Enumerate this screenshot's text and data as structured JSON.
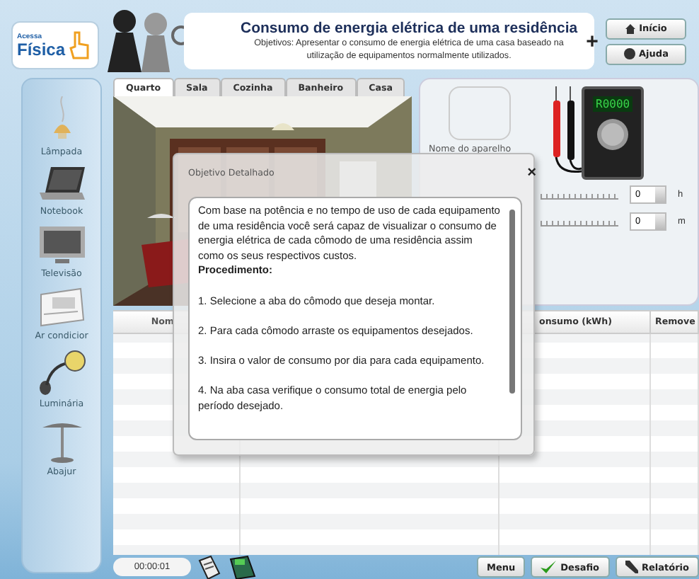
{
  "logo": {
    "top": "Acessa",
    "bottom": "Física"
  },
  "header": {
    "title": "Consumo de energia elétrica de uma residência",
    "objective": "Objetivos: Apresentar o consumo de energia elétrica de uma casa baseado na utilização de equipamentos normalmente utilizados.",
    "expand": "+",
    "buttons": [
      {
        "label": "Início"
      },
      {
        "label": "Ajuda"
      }
    ]
  },
  "sidebar": {
    "items": [
      {
        "label": "Lâmpada"
      },
      {
        "label": "Notebook"
      },
      {
        "label": "Televisão"
      },
      {
        "label": "Ar condicior"
      },
      {
        "label": "Luminária"
      },
      {
        "label": "Abajur"
      }
    ]
  },
  "tabs": [
    {
      "label": "Quarto",
      "selected": true
    },
    {
      "label": "Sala",
      "selected": false
    },
    {
      "label": "Cozinha",
      "selected": false
    },
    {
      "label": "Banheiro",
      "selected": false
    },
    {
      "label": "Casa",
      "selected": false
    }
  ],
  "device": {
    "name_label": "Nome do aparelho",
    "meter_display": "R0000",
    "inputs": [
      {
        "value": "0",
        "unit": "h"
      },
      {
        "value": "0",
        "unit": "m"
      }
    ]
  },
  "table": {
    "headers": {
      "column_1": "Nom",
      "column_3": "onsumo (kWh)",
      "column_4": "Remove"
    }
  },
  "dialog": {
    "title": "Objetivo Detalhado",
    "close": "×",
    "paragraphs": [
      {
        "kind": "text",
        "text": "Com base na potência e no tempo de uso de cada equipamento de uma residência você será capaz de visualizar o consumo de energia elétrica de cada cômodo de uma residência assim como os seus respectivos custos."
      },
      {
        "kind": "heading",
        "text": "Procedimento:"
      },
      {
        "kind": "step",
        "text": "1. Selecione a aba do cômodo que deseja montar."
      },
      {
        "kind": "step",
        "text": "2. Para cada cômodo arraste os equipamentos desejados."
      },
      {
        "kind": "step",
        "text": "3. Insira o valor de consumo por dia para cada equipamento."
      },
      {
        "kind": "step",
        "text": "4. Na aba casa verifique o consumo total de energia pelo período desejado."
      }
    ]
  },
  "status_bar": {
    "timer": "00:00:01",
    "buttons": [
      {
        "label": "Menu"
      },
      {
        "label": "Desafio"
      },
      {
        "label": "Relatório"
      }
    ]
  }
}
